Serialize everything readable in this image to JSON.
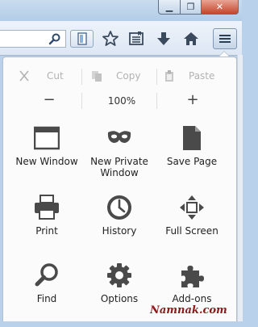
{
  "window": {
    "minimize_glyph": "▁",
    "maximize_glyph": "❐",
    "close_glyph": "✕"
  },
  "toolbar": {
    "icons": [
      "search-icon",
      "reader-view-icon",
      "bookmark-star-icon",
      "bookmarks-list-icon",
      "download-icon",
      "home-icon",
      "hamburger-menu-icon"
    ]
  },
  "edit": {
    "cut": "Cut",
    "copy": "Copy",
    "paste": "Paste"
  },
  "zoom": {
    "out": "−",
    "level": "100%",
    "in": "+"
  },
  "menu_items": [
    {
      "label": "New Window",
      "icon": "new-window-icon"
    },
    {
      "label": "New Private Window",
      "icon": "private-mask-icon"
    },
    {
      "label": "Save Page",
      "icon": "save-page-icon"
    },
    {
      "label": "Print",
      "icon": "printer-icon"
    },
    {
      "label": "History",
      "icon": "clock-icon"
    },
    {
      "label": "Full Screen",
      "icon": "fullscreen-icon"
    },
    {
      "label": "Find",
      "icon": "magnifier-icon"
    },
    {
      "label": "Options",
      "icon": "gear-icon"
    },
    {
      "label": "Add-ons",
      "icon": "puzzle-icon"
    }
  ],
  "watermark": "Namnak.com",
  "colors": {
    "icon_gray": "#4a4a4a",
    "disabled_gray": "#b2b2b2",
    "toolbar_icon": "#3b4a5c"
  }
}
